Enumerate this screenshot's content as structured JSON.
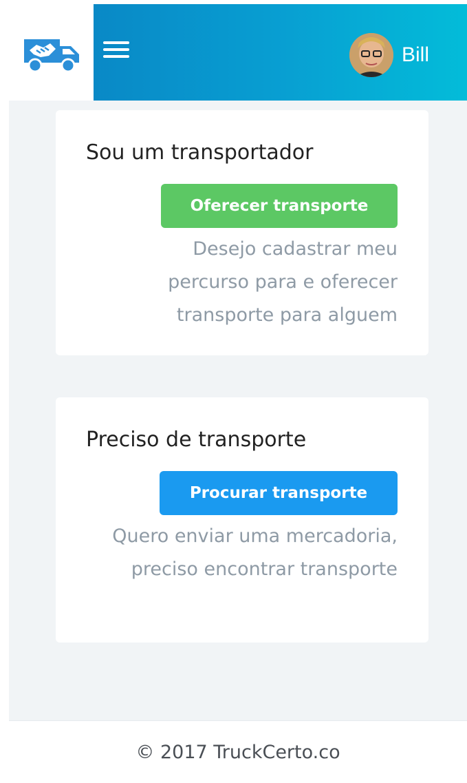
{
  "header": {
    "logo_icon": "truck-handshake-icon",
    "menu_icon": "hamburger-menu-icon",
    "user": {
      "name": "Bill",
      "avatar_icon": "user-avatar"
    },
    "colors": {
      "gradient_start": "#0a7fc1",
      "gradient_end": "#03bcd9",
      "logo_blue": "#2b8fd8"
    }
  },
  "cards": [
    {
      "title": "Sou um transportador",
      "button_label": "Oferecer transporte",
      "button_color": "#5cc864",
      "description": "Desejo cadastrar meu percurso para e oferecer transporte para alguem"
    },
    {
      "title": "Preciso de transporte",
      "button_label": "Procurar transporte",
      "button_color": "#1a9af0",
      "description": "Quero enviar uma mercadoria, preciso encontrar transporte"
    }
  ],
  "footer": {
    "copyright": "© 2017 TruckCerto.co"
  }
}
